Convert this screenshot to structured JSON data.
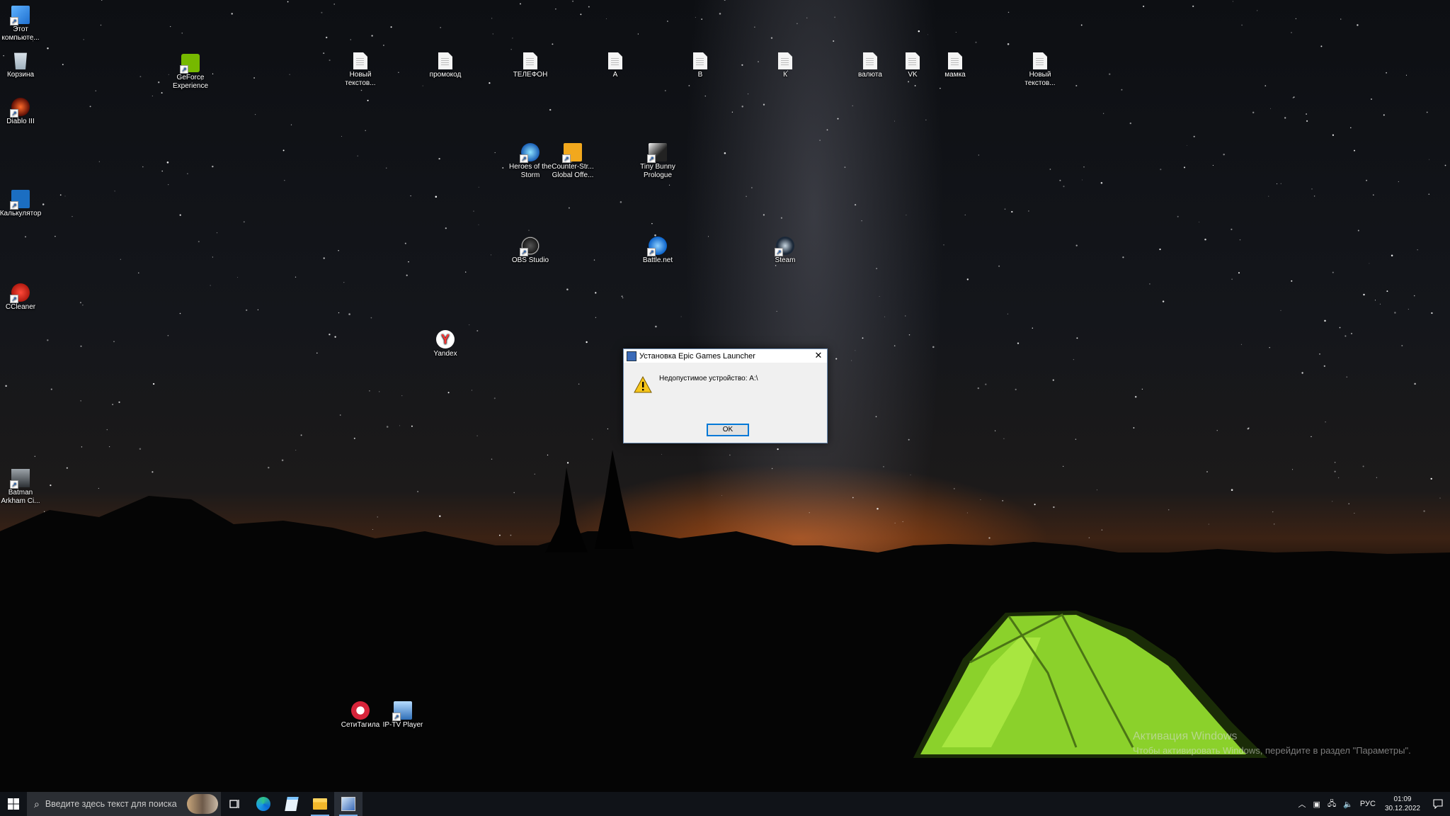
{
  "desktop_icons": [
    {
      "id": "this-pc",
      "label": "Этот\nкомпьюте...",
      "icon": "computer-icon"
    },
    {
      "id": "recycle-bin",
      "label": "Корзина",
      "icon": "recycle-bin-icon"
    },
    {
      "id": "diablo",
      "label": "Diablo III",
      "icon": "diablo-icon"
    },
    {
      "id": "calculator",
      "label": "Калькулятор",
      "icon": "calculator-icon"
    },
    {
      "id": "ccleaner",
      "label": "CCleaner",
      "icon": "ccleaner-icon"
    },
    {
      "id": "batman",
      "label": "Batman\nArkham Ci...",
      "icon": "batman-icon"
    },
    {
      "id": "geforce",
      "label": "GeForce\nExperience",
      "icon": "geforce-icon"
    },
    {
      "id": "new-text-1",
      "label": "Новый\nтекстов...",
      "icon": "text-document-icon"
    },
    {
      "id": "promokod",
      "label": "промокод",
      "icon": "text-document-icon"
    },
    {
      "id": "telefon",
      "label": "ТЕЛЕФОН",
      "icon": "text-document-icon"
    },
    {
      "id": "doc-a",
      "label": "А",
      "icon": "text-document-icon"
    },
    {
      "id": "doc-v",
      "label": "В",
      "icon": "text-document-icon"
    },
    {
      "id": "doc-k",
      "label": "К",
      "icon": "text-document-icon"
    },
    {
      "id": "valuta",
      "label": "валюта",
      "icon": "text-document-icon"
    },
    {
      "id": "vk",
      "label": "VK",
      "icon": "text-document-icon"
    },
    {
      "id": "mamka",
      "label": "мамка",
      "icon": "text-document-icon"
    },
    {
      "id": "new-text-2",
      "label": "Новый\nтекстов...",
      "icon": "text-document-icon"
    },
    {
      "id": "hots",
      "label": "Heroes of the\nStorm",
      "icon": "heroes-of-the-storm-icon"
    },
    {
      "id": "csgo",
      "label": "Counter-Str...\nGlobal Offe...",
      "icon": "csgo-icon"
    },
    {
      "id": "tiny-bunny",
      "label": "Tiny Bunny\nPrologue",
      "icon": "tiny-bunny-icon"
    },
    {
      "id": "obs",
      "label": "OBS Studio",
      "icon": "obs-icon"
    },
    {
      "id": "battlenet",
      "label": "Battle.net",
      "icon": "battlenet-icon"
    },
    {
      "id": "steam",
      "label": "Steam",
      "icon": "steam-icon"
    },
    {
      "id": "yandex",
      "label": "Yandex",
      "icon": "yandex-icon"
    },
    {
      "id": "seti-tagila",
      "label": "СетиТагила",
      "icon": "seti-tagila-icon"
    },
    {
      "id": "iptv",
      "label": "IP-TV Player",
      "icon": "iptv-player-icon"
    }
  ],
  "dialog": {
    "title": "Установка Epic Games Launcher",
    "message": "Недопустимое устройство: A:\\",
    "ok_label": "OK",
    "icon": "warning-icon"
  },
  "watermark": {
    "title": "Активация Windows",
    "subtitle": "Чтобы активировать Windows, перейдите в раздел \"Параметры\"."
  },
  "taskbar": {
    "search_placeholder": "Введите здесь текст для поиска",
    "apps": [
      "task-view-icon",
      "edge-icon",
      "notepad-icon",
      "file-explorer-icon",
      "installer-icon"
    ],
    "language": "РУС",
    "time": "01:09",
    "date": "30.12.2022"
  },
  "colors": {
    "taskbar": "#101318",
    "dialog_bg": "#f0f0f0",
    "accent": "#0078d7",
    "tent": "#8bd12b"
  }
}
